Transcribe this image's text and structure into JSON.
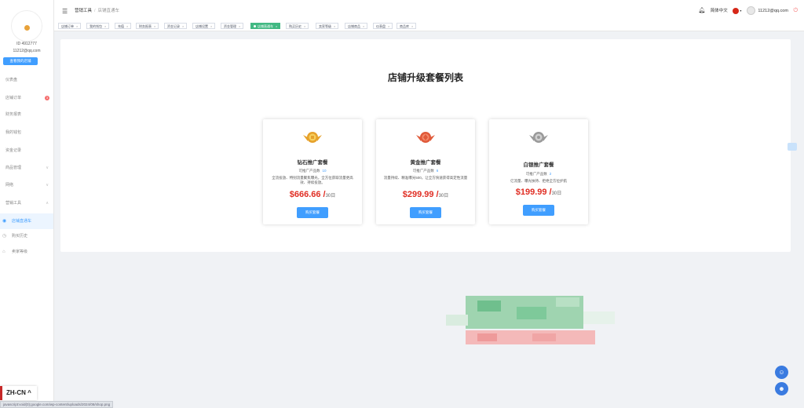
{
  "sidebar": {
    "user_id": "ID 4912777",
    "email": "11212@qq.com",
    "shop_button": "查看我的店铺",
    "items": [
      {
        "label": "仪表盘"
      },
      {
        "label": "店铺订单",
        "badge": "3"
      },
      {
        "label": "财务报表"
      },
      {
        "label": "我的钱包"
      },
      {
        "label": "资金记录"
      },
      {
        "label": "商品管理",
        "arrow": "∨"
      },
      {
        "label": "网络",
        "arrow": "∨"
      },
      {
        "label": "营销工具",
        "arrow": "∧"
      }
    ],
    "sub_items": [
      {
        "label": "店铺直通车",
        "icon": "eye-icon"
      },
      {
        "label": "购买历史",
        "icon": "clock-icon"
      },
      {
        "label": "卖家等级",
        "icon": "house-icon"
      }
    ]
  },
  "header": {
    "breadcrumb_root": "营销工具",
    "breadcrumb_sep": "/",
    "breadcrumb_current": "店铺直通车",
    "language": "简体中文",
    "user_email": "11212@qq.com"
  },
  "tabs": [
    {
      "label": "店铺订单"
    },
    {
      "label": "我的钱包"
    },
    {
      "label": "充值"
    },
    {
      "label": "财务报表"
    },
    {
      "label": "资金记录"
    },
    {
      "label": "店铺设置"
    },
    {
      "label": "资金管理"
    },
    {
      "label": "店铺直通车",
      "active": true
    },
    {
      "label": "购买历史"
    },
    {
      "label": "卖家等级"
    },
    {
      "label": "店铺商品"
    },
    {
      "label": "仪表盘"
    },
    {
      "label": "商品库"
    }
  ],
  "page": {
    "title": "店铺升级套餐列表"
  },
  "packages": [
    {
      "name": "钻石推广套餐",
      "count_label": "可推广产品数",
      "count": "10",
      "desc": "全流投放、特别流量聚焦曝光，全方位获取流量更高效、持续投放。",
      "price": "$666.66 /",
      "period": "30日",
      "button": "购买套餐",
      "medal_color": "#e6a12b"
    },
    {
      "name": "黄金推广套餐",
      "count_label": "可推广产品数",
      "count": "6",
      "desc": "流量持续、精准曝光500，让全方快速获得高定性流量",
      "price": "$299.99 /",
      "period": "30日",
      "button": "购买套餐",
      "medal_color": "#e05a3a"
    },
    {
      "name": "白银推广套餐",
      "count_label": "可推广产品数",
      "count": "2",
      "desc": "亿流量、曝光扶持、拒绝全方位护航",
      "price": "$199.99 /",
      "period": "30日",
      "button": "购买套餐",
      "medal_color": "#9a9a9a"
    }
  ],
  "language_switcher": "ZH-CN ^",
  "status_url": "javascript:void(0);google.com/wp-content/uploads/2024/08/shop.png"
}
